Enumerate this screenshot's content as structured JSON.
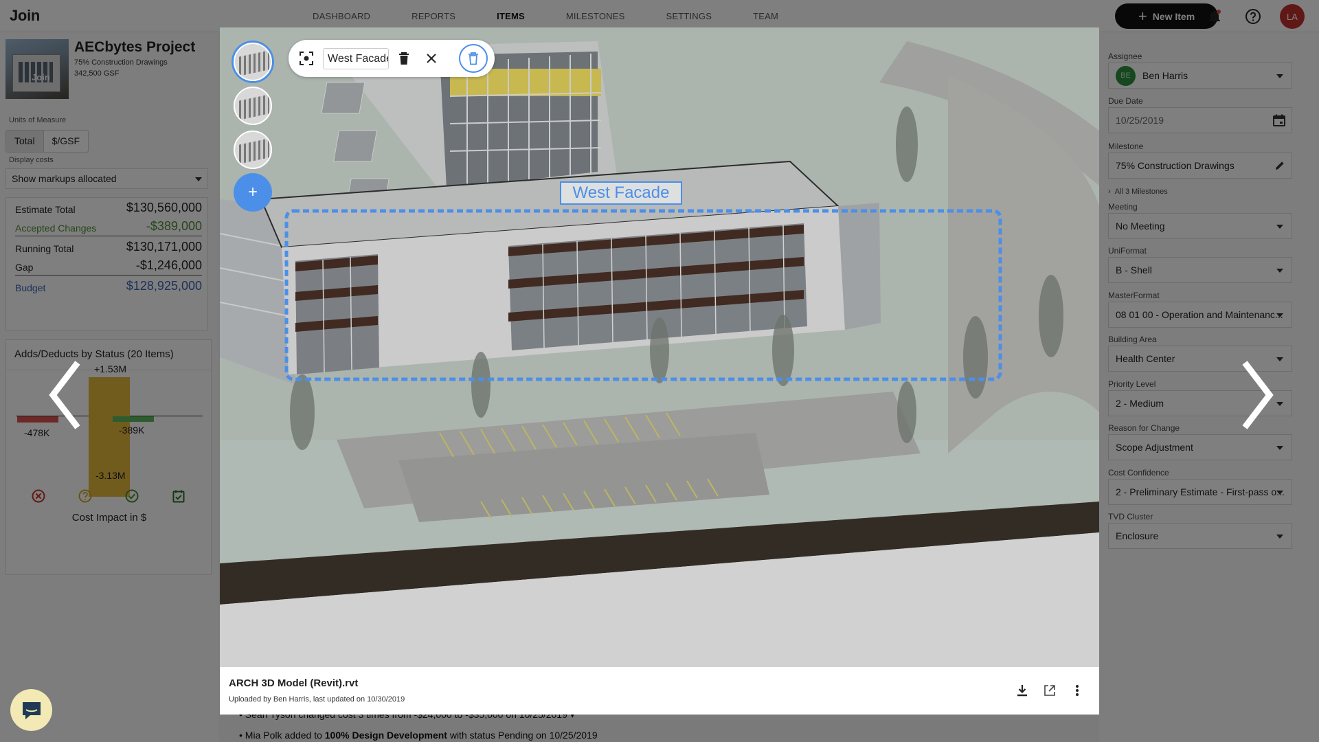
{
  "app": {
    "logo": "Join"
  },
  "nav": {
    "items": [
      "DASHBOARD",
      "REPORTS",
      "ITEMS",
      "MILESTONES",
      "SETTINGS",
      "TEAM"
    ],
    "active": "ITEMS",
    "new_item_label": "New Item",
    "user_initials": "LA"
  },
  "project": {
    "name": "AECbytes Project",
    "milestone": "75% Construction Drawings",
    "size": "342,500 GSF",
    "thumb_tag": "Join"
  },
  "units": {
    "label": "Units of Measure",
    "options": [
      "Total",
      "$/GSF"
    ],
    "selected": "Total"
  },
  "display_costs": {
    "label": "Display costs",
    "value": "Show markups allocated"
  },
  "estimate": [
    {
      "label": "Estimate Total",
      "value": "$130,560,000",
      "style": "normal"
    },
    {
      "label": "Accepted Changes",
      "value": "-$389,000",
      "style": "green"
    },
    {
      "label": "Running Total",
      "value": "$130,171,000",
      "style": "normal"
    },
    {
      "label": "Gap",
      "value": "-$1,246,000",
      "style": "normal"
    },
    {
      "label": "Budget",
      "value": "$128,925,000",
      "style": "blue"
    }
  ],
  "adds_deducts": {
    "title": "Adds/Deducts by Status (20 Items)",
    "caption": "Cost Impact in $",
    "labels": [
      "+1.53M",
      "-478K",
      "-389K",
      "-3.13M"
    ],
    "status_icons": [
      "rejected-icon",
      "pending-icon",
      "accepted-icon",
      "incorporated-icon"
    ],
    "colors": {
      "rejected": "#d9534f",
      "pending": "#e2b93b",
      "accepted": "#5cb85c"
    }
  },
  "activity": [
    {
      "text": "Sean Tyson changed cost 3 times from -$24,000 to -$35,000 on 10/25/2019"
    },
    {
      "prefix": "Mia Polk added to ",
      "bold": "100% Design Development",
      "suffix": " with status Pending on 10/25/2019"
    }
  ],
  "viewer": {
    "markup_name": "West Facade",
    "markup_label": "West Facade",
    "file_name": "ARCH 3D Model (Revit).rvt",
    "file_meta": "Uploaded by Ben Harris, last updated on 10/30/2019",
    "accent": "#4c8fe8"
  },
  "fields": [
    {
      "label": "Assignee",
      "value": "Ben Harris",
      "avatar": "BE",
      "control": "dropdown"
    },
    {
      "label": "Due Date",
      "value": "10/25/2019",
      "control": "date"
    },
    {
      "label": "Milestone",
      "value": "75% Construction Drawings",
      "control": "edit"
    },
    {
      "label": "Meeting",
      "value": "No Meeting",
      "control": "dropdown"
    },
    {
      "label": "UniFormat",
      "value": "B - Shell",
      "control": "dropdown"
    },
    {
      "label": "MasterFormat",
      "value": "08 01 00 - Operation and Maintenanc...",
      "control": "dropdown"
    },
    {
      "label": "Building Area",
      "value": "Health Center",
      "control": "dropdown"
    },
    {
      "label": "Priority Level",
      "value": "2 - Medium",
      "control": "dropdown"
    },
    {
      "label": "Reason for Change",
      "value": "Scope Adjustment",
      "control": "dropdown"
    },
    {
      "label": "Cost Confidence",
      "value": "2 - Preliminary Estimate - First-pass o...",
      "control": "dropdown"
    },
    {
      "label": "TVD Cluster",
      "value": "Enclosure",
      "control": "dropdown"
    }
  ],
  "milestones_link": "All 3 Milestones"
}
